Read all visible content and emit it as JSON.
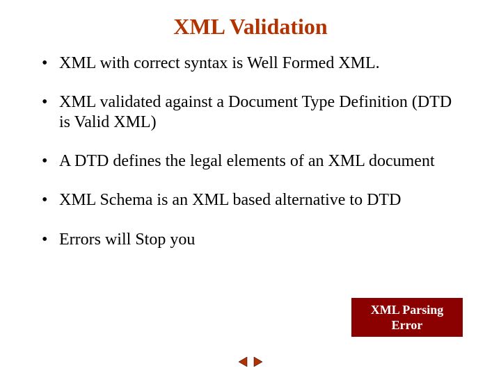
{
  "title": "XML Validation",
  "bullets": [
    "XML with correct syntax is Well Formed XML.",
    "XML validated against a Document Type Definition (DTD is Valid XML)",
    "A DTD defines the legal elements of an XML document",
    "XML Schema is an XML based alternative to DTD",
    "Errors will Stop you"
  ],
  "badge": {
    "line1": "XML Parsing",
    "line2": "Error"
  },
  "colors": {
    "title": "#b33300",
    "badge_bg": "#8b0000",
    "nav_arrow": "#b33300"
  }
}
